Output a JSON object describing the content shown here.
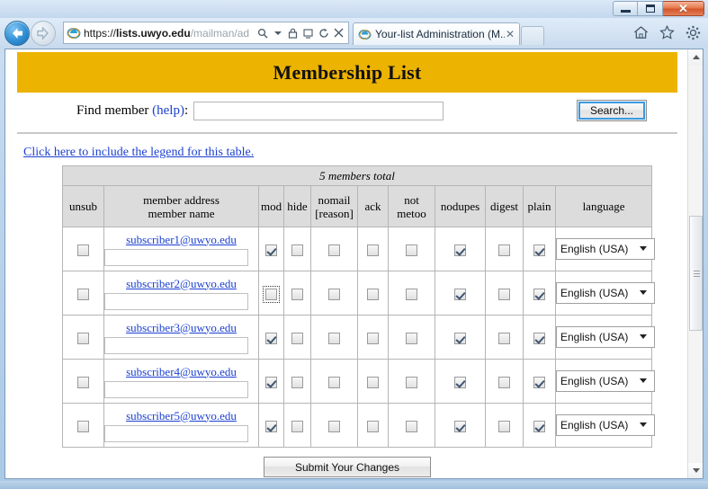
{
  "window": {
    "controls": {
      "minimize_label": "Minimize",
      "maximize_label": "Maximize",
      "close_label": "✕"
    }
  },
  "browser": {
    "back_label": "Back",
    "forward_label": "Forward",
    "address": {
      "scheme": "https://",
      "host": "lists.uwyo.edu",
      "path": "/mailman/ad",
      "full": "https://lists.uwyo.edu/mailman/ad"
    },
    "address_icons": [
      "search-icon",
      "dropdown-icon",
      "lock-icon",
      "compatibility-icon",
      "refresh-icon",
      "stop-icon"
    ],
    "tab": {
      "title": "Your-list Administration (M...",
      "close_label": "✕"
    },
    "toolbar_icons": [
      "home-icon",
      "favorites-star-icon",
      "settings-gear-icon"
    ]
  },
  "page": {
    "banner_title": "Membership List",
    "find": {
      "label_prefix": "Find member",
      "help_label": "(help)",
      "label_suffix": ":",
      "input_value": "",
      "input_placeholder": "",
      "search_button": "Search..."
    },
    "legend_link": "Click here to include the legend for this table.",
    "total_text": "5 members total",
    "columns": [
      "unsub",
      "member address\nmember name",
      "mod",
      "hide",
      "nomail\n[reason]",
      "ack",
      "not\nmetoo",
      "nodupes",
      "digest",
      "plain",
      "language"
    ],
    "column_header_lines": {
      "unsub": [
        "unsub"
      ],
      "address": [
        "member address",
        "member name"
      ],
      "mod": [
        "mod"
      ],
      "hide": [
        "hide"
      ],
      "nomail": [
        "nomail",
        "[reason]"
      ],
      "ack": [
        "ack"
      ],
      "notmetoo": [
        "not",
        "metoo"
      ],
      "nodupes": [
        "nodupes"
      ],
      "digest": [
        "digest"
      ],
      "plain": [
        "plain"
      ],
      "language": [
        "language"
      ]
    },
    "language_selected": "English (USA)",
    "language_options": [
      "English (USA)"
    ],
    "members": [
      {
        "email": "subscriber1@uwyo.edu",
        "name": "",
        "unsub": false,
        "mod": true,
        "hide": false,
        "nomail": false,
        "ack": false,
        "notmetoo": false,
        "nodupes": true,
        "digest": false,
        "plain": true,
        "mod_focused": false,
        "language": "English (USA)"
      },
      {
        "email": "subscriber2@uwyo.edu",
        "name": "",
        "unsub": false,
        "mod": false,
        "hide": false,
        "nomail": false,
        "ack": false,
        "notmetoo": false,
        "nodupes": true,
        "digest": false,
        "plain": true,
        "mod_focused": true,
        "language": "English (USA)"
      },
      {
        "email": "subscriber3@uwyo.edu",
        "name": "",
        "unsub": false,
        "mod": true,
        "hide": false,
        "nomail": false,
        "ack": false,
        "notmetoo": false,
        "nodupes": true,
        "digest": false,
        "plain": true,
        "mod_focused": false,
        "language": "English (USA)"
      },
      {
        "email": "subscriber4@uwyo.edu",
        "name": "",
        "unsub": false,
        "mod": true,
        "hide": false,
        "nomail": false,
        "ack": false,
        "notmetoo": false,
        "nodupes": true,
        "digest": false,
        "plain": true,
        "mod_focused": false,
        "language": "English (USA)"
      },
      {
        "email": "subscriber5@uwyo.edu",
        "name": "",
        "unsub": false,
        "mod": true,
        "hide": false,
        "nomail": false,
        "ack": false,
        "notmetoo": false,
        "nodupes": true,
        "digest": false,
        "plain": true,
        "mod_focused": false,
        "language": "English (USA)"
      }
    ],
    "submit_button": "Submit Your Changes"
  },
  "colors": {
    "banner_gold": "#ecb300",
    "link_blue": "#1a3fd0",
    "table_header_gray": "#dcdcdc",
    "focus_blue": "#3c9ae0"
  }
}
